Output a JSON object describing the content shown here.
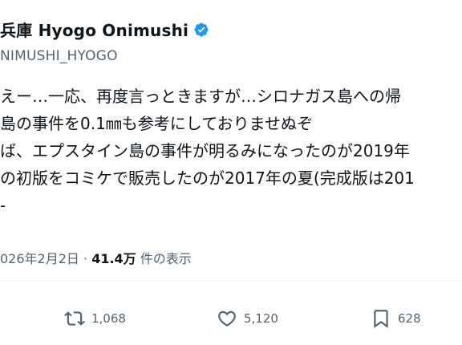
{
  "author": {
    "display_name": "兵庫 Hyogo Onimushi",
    "handle": "NIMUSHI_HYOGO",
    "verified_icon": "verified-badge-icon",
    "verified_color": "#1d9bf0"
  },
  "tweet": {
    "lines": [
      "えー…一応、再度言っときますが…シロナガス島への帰",
      "島の事件を0.1㎜も参考にしておりませぬぞ",
      "ば、エプスタイン島の事件が明るみになったのが2019年",
      "の初版をコミケで販売したのが2017年の夏(完成版は201",
      "-"
    ]
  },
  "meta": {
    "date": "026年2月2日",
    "separator": "·",
    "views": "41.4万",
    "views_suffix": "件の表示"
  },
  "actions": [
    {
      "name": "retweet",
      "icon": "retweet-icon",
      "count": "1,068"
    },
    {
      "name": "like",
      "icon": "heart-icon",
      "count": "5,120"
    },
    {
      "name": "bookmark",
      "icon": "bookmark-icon",
      "count": "628"
    }
  ],
  "colors": {
    "text_primary": "#0f1419",
    "text_secondary": "#536471",
    "accent": "#1d9bf0",
    "divider": "#eff3f4"
  }
}
